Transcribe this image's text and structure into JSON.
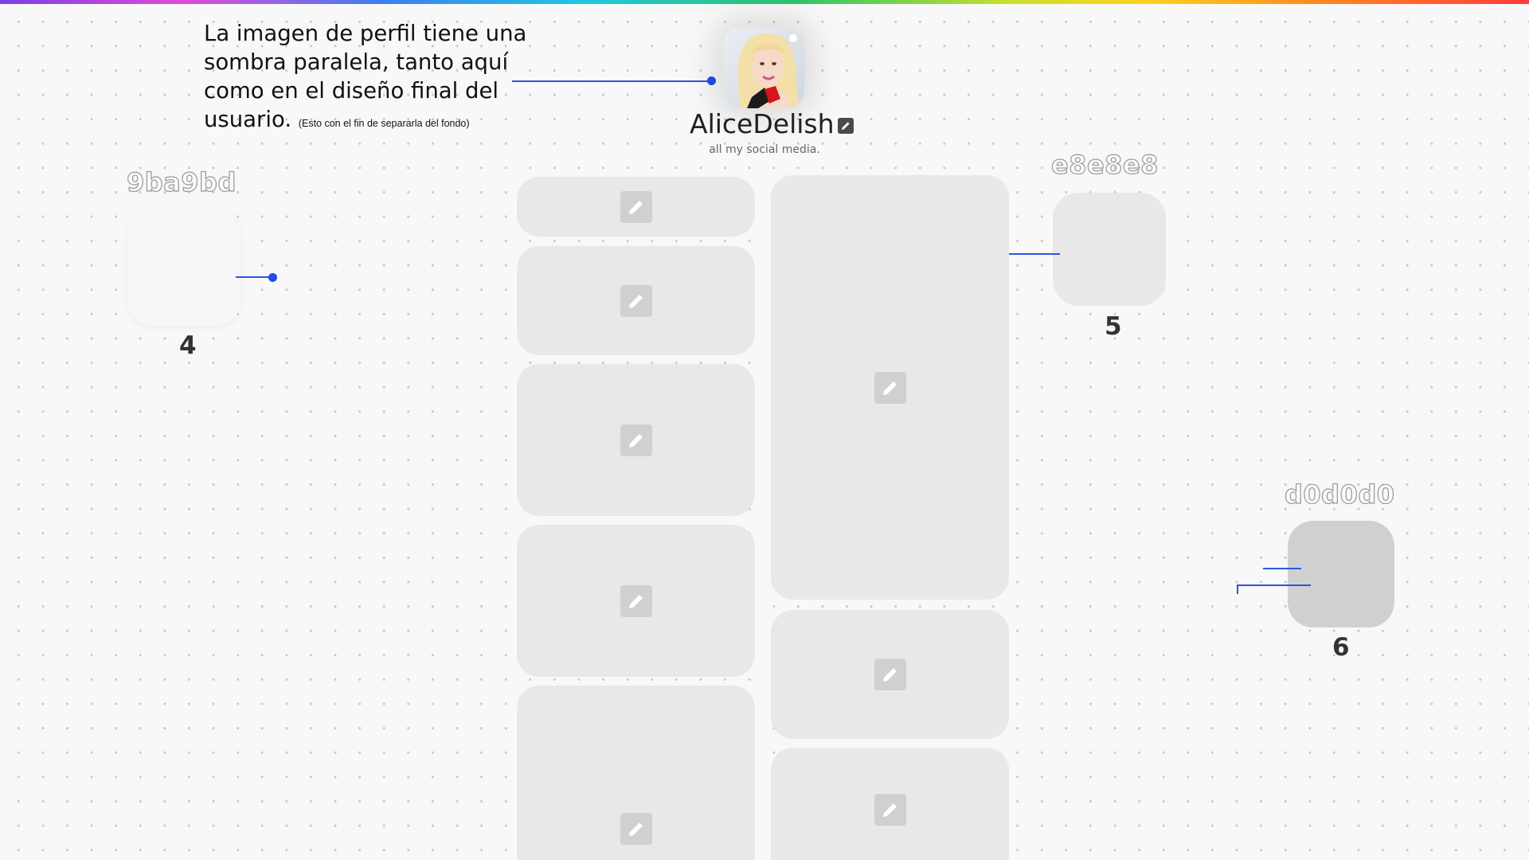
{
  "annotation": {
    "text": "La imagen de perfil tiene una sombra paralela, tanto aquí como en el diseño final del usuario.",
    "small_text": "(Esto con el fin de separarla del fondo)"
  },
  "profile": {
    "username": "AliceDelish",
    "bio": "all my social media."
  },
  "swatches": [
    {
      "label": "9ba9bd",
      "number": "4",
      "fill": "#f7f7f7"
    },
    {
      "label": "e8e8e8",
      "number": "5",
      "fill": "#e8e8e8"
    },
    {
      "label": "d0d0d0",
      "number": "6",
      "fill": "#d0d0d0"
    }
  ],
  "colors": {
    "link_card": "#e8e8e8",
    "edit_icon_bg": "#d0d0d0",
    "connector": "#2b55e6",
    "background": "#f8f8f8"
  },
  "icons": [
    "pencil-icon",
    "edit-badge-icon"
  ]
}
